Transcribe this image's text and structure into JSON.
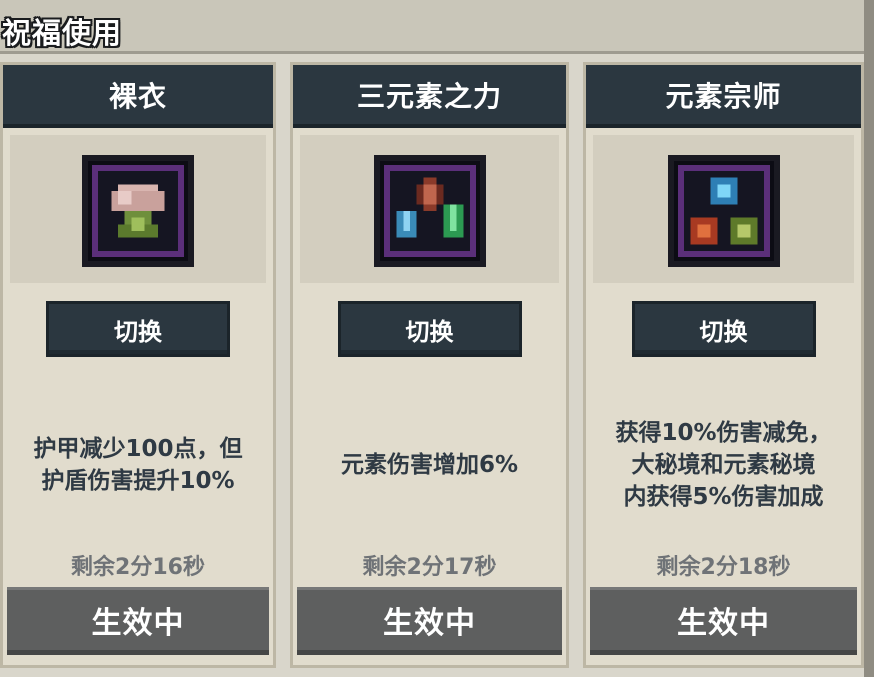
{
  "panel": {
    "title": "祝福使用"
  },
  "cards": [
    {
      "name": "裸衣",
      "icon": "naked-cloth-icon",
      "switch_label": "切换",
      "description": "护甲减少100点，但\n护盾伤害提升10%",
      "remaining": "剩余2分16秒",
      "status": "生效中"
    },
    {
      "name": "三元素之力",
      "icon": "three-elements-icon",
      "switch_label": "切换",
      "description": "元素伤害增加6%",
      "remaining": "剩余2分17秒",
      "status": "生效中"
    },
    {
      "name": "元素宗师",
      "icon": "element-master-icon",
      "switch_label": "切换",
      "description": "获得10%伤害减免，\n大秘境和元素秘境\n内获得5%伤害加成",
      "remaining": "剩余2分18秒",
      "status": "生效中"
    }
  ],
  "colors": {
    "header_dark": "#2b3740",
    "card_bg": "#e1dccd",
    "status_gray": "#5e5f5f",
    "icon_border_purple": "#5b2f7a"
  }
}
